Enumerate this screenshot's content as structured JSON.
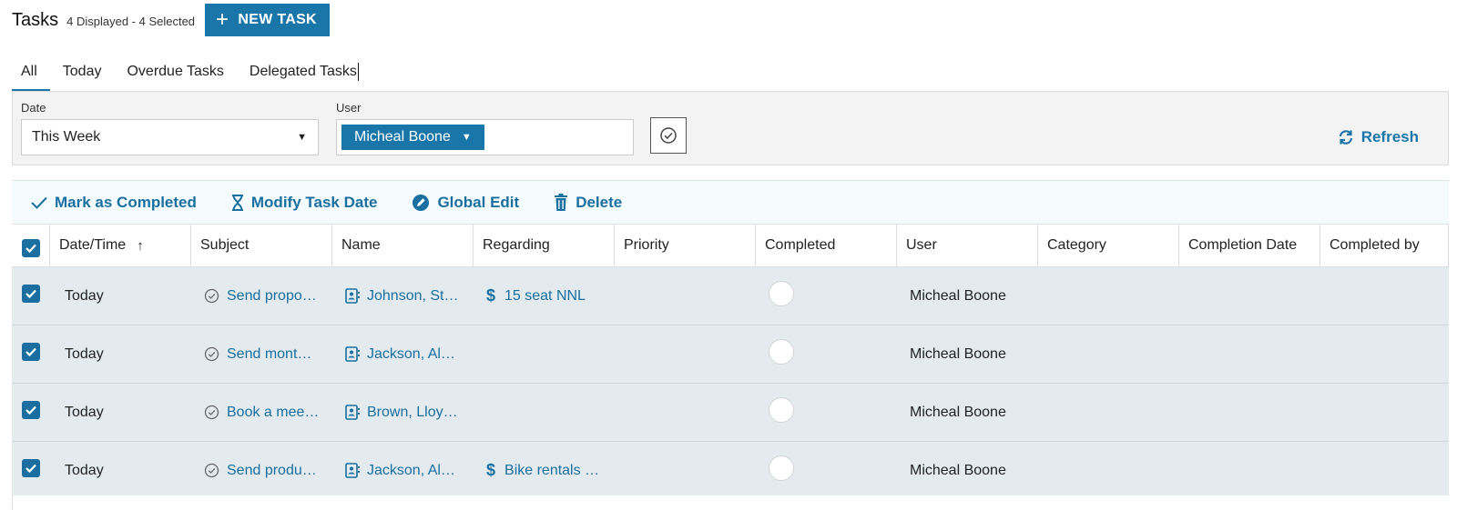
{
  "header": {
    "title": "Tasks",
    "counts": "4 Displayed - 4 Selected",
    "new_task_label": "NEW TASK"
  },
  "tabs": [
    {
      "label": "All",
      "active": true
    },
    {
      "label": "Today",
      "active": false
    },
    {
      "label": "Overdue Tasks",
      "active": false
    },
    {
      "label": "Delegated Tasks",
      "active": false
    }
  ],
  "filters": {
    "date_label": "Date",
    "date_value": "This Week",
    "user_label": "User",
    "user_value": "Micheal Boone",
    "refresh_label": "Refresh"
  },
  "actions": {
    "mark_completed": "Mark as Completed",
    "modify_date": "Modify Task Date",
    "global_edit": "Global Edit",
    "delete": "Delete"
  },
  "table": {
    "columns": [
      "Date/Time",
      "Subject",
      "Name",
      "Regarding",
      "Priority",
      "Completed",
      "User",
      "Category",
      "Completion Date",
      "Completed by"
    ],
    "rows": [
      {
        "date": "Today",
        "subject": "Send propo…",
        "name": "Johnson, St…",
        "regarding": "15 seat NNL",
        "user": "Micheal Boone"
      },
      {
        "date": "Today",
        "subject": "Send mont…",
        "name": "Jackson, Al…",
        "regarding": "",
        "user": "Micheal Boone"
      },
      {
        "date": "Today",
        "subject": "Book a mee…",
        "name": "Brown, Lloy…",
        "regarding": "",
        "user": "Micheal Boone"
      },
      {
        "date": "Today",
        "subject": "Send produ…",
        "name": "Jackson, Al…",
        "regarding": "Bike rentals …",
        "user": "Micheal Boone"
      }
    ]
  },
  "colors": {
    "accent": "#1a76a8",
    "row_bg": "#e3ebef",
    "filter_bg": "#f3f3f3"
  }
}
